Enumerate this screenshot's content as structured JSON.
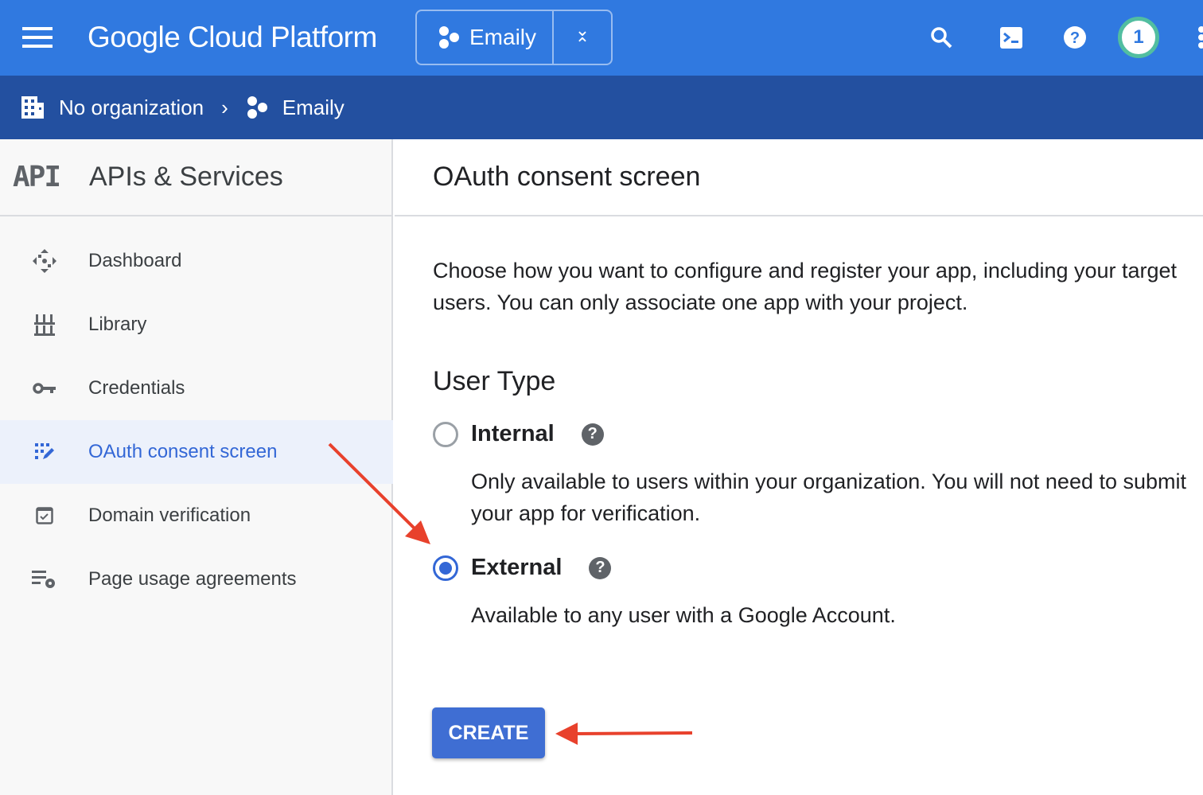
{
  "header": {
    "title": "Google Cloud Platform",
    "project": "Emaily",
    "notifications": "1",
    "icons": [
      "menu-icon",
      "project-hex-icon",
      "swap-icon",
      "search-icon",
      "cloud-shell-icon",
      "help-icon",
      "more-vert-icon"
    ]
  },
  "breadcrumb": {
    "org": "No organization",
    "project": "Emaily"
  },
  "sidebar": {
    "badge": "API",
    "title": "APIs & Services",
    "items": [
      {
        "label": "Dashboard",
        "icon": "dashboard-icon"
      },
      {
        "label": "Library",
        "icon": "library-icon"
      },
      {
        "label": "Credentials",
        "icon": "key-icon"
      },
      {
        "label": "OAuth consent screen",
        "icon": "oauth-icon",
        "active": true
      },
      {
        "label": "Domain verification",
        "icon": "checkbox-icon"
      },
      {
        "label": "Page usage agreements",
        "icon": "settings-list-icon"
      }
    ]
  },
  "main": {
    "title": "OAuth consent screen",
    "description": "Choose how you want to configure and register your app, including your target users. You can only associate one app with your project.",
    "section": "User Type",
    "options": [
      {
        "label": "Internal",
        "description": "Only available to users within your organization. You will not need to submit your app for verification.",
        "selected": false
      },
      {
        "label": "External",
        "description": "Available to any user with a Google Account.",
        "selected": true
      }
    ],
    "create_label": "CREATE"
  },
  "colors": {
    "topbar": "#3079e0",
    "subbar": "#2350a0",
    "accent": "#3367d6",
    "annotation": "#e8412c"
  }
}
